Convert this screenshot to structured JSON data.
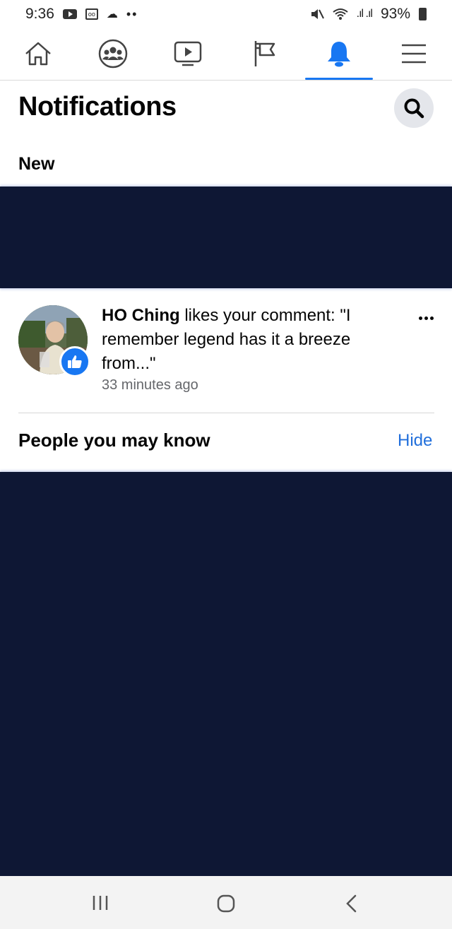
{
  "status_bar": {
    "time": "9:36",
    "battery": "93%",
    "icons": [
      "youtube-icon",
      "voicemail-icon",
      "cloud-upload-icon",
      "mute-icon",
      "wifi-icon",
      "signal-icon",
      "battery-icon"
    ]
  },
  "top_nav": {
    "tabs": [
      "home-icon",
      "groups-icon",
      "watch-icon",
      "pages-flag-icon",
      "notifications-bell-icon",
      "menu-icon"
    ],
    "active_tab": "notifications-bell-icon",
    "accent_color": "#1877f2"
  },
  "header": {
    "title": "Notifications"
  },
  "sections": {
    "new_label": "New",
    "people_title": "People you may know",
    "hide_label": "Hide"
  },
  "notification": {
    "name": "HO Ching",
    "text": " likes your comment: \"I remember legend has it a breeze from...\"",
    "time": "33 minutes ago"
  },
  "colors": {
    "dark_block": "#0e1734",
    "link": "#216fdb"
  }
}
